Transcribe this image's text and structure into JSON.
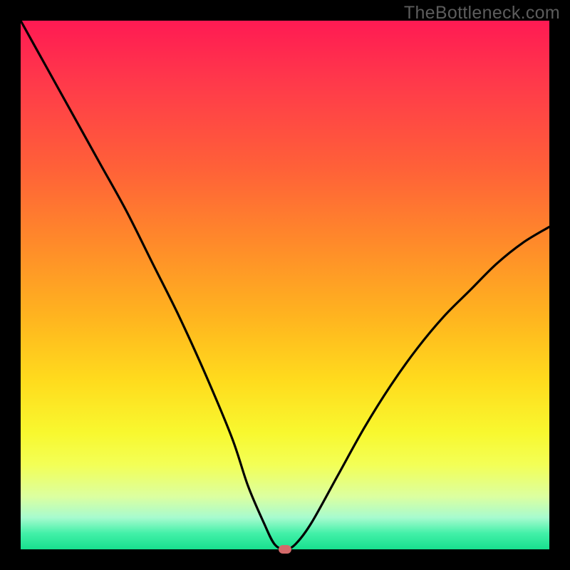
{
  "watermark": "TheBottleneck.com",
  "chart_data": {
    "type": "line",
    "title": "",
    "xlabel": "",
    "ylabel": "",
    "xlim": [
      0,
      100
    ],
    "ylim": [
      0,
      100
    ],
    "grid": false,
    "series": [
      {
        "name": "curve",
        "x": [
          0,
          5,
          10,
          15,
          20,
          25,
          30,
          35,
          40,
          43,
          46,
          48,
          50,
          52,
          55,
          60,
          65,
          70,
          75,
          80,
          85,
          90,
          95,
          100
        ],
        "y": [
          100,
          91,
          82,
          73,
          64,
          54,
          44,
          33,
          21,
          12,
          5,
          1,
          0,
          1,
          5,
          14,
          23,
          31,
          38,
          44,
          49,
          54,
          58,
          61
        ]
      }
    ],
    "marker": {
      "x": 50,
      "y": 0
    },
    "background_gradient": {
      "top": "#ff1a53",
      "mid": "#ffdb1d",
      "bottom": "#18e08e"
    }
  }
}
